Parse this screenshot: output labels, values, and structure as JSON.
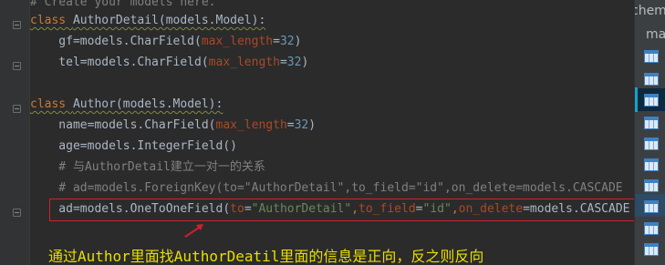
{
  "editor": {
    "lines": [
      {
        "id": "l0",
        "parts": [
          [
            "cmt",
            "# Create your models here."
          ]
        ]
      },
      {
        "id": "l1",
        "parts": [
          [
            "kw",
            "class "
          ],
          [
            "cls",
            "AuthorDetail(models.Model):"
          ]
        ]
      },
      {
        "id": "l2",
        "parts": [
          [
            "cls",
            "    gf=models.CharField("
          ],
          [
            "param",
            "max_length"
          ],
          [
            "cls",
            "="
          ],
          [
            "num",
            "32"
          ],
          [
            "cls",
            ")"
          ]
        ]
      },
      {
        "id": "l3",
        "parts": [
          [
            "cls",
            "    tel=models.CharField("
          ],
          [
            "param",
            "max_length"
          ],
          [
            "cls",
            "="
          ],
          [
            "num",
            "32"
          ],
          [
            "cls",
            ")"
          ]
        ]
      },
      {
        "id": "l4",
        "parts": []
      },
      {
        "id": "l5",
        "parts": [
          [
            "kw",
            "class "
          ],
          [
            "cls",
            "Author(models.Model):"
          ]
        ]
      },
      {
        "id": "l6",
        "parts": [
          [
            "cls",
            "    name=models.CharField("
          ],
          [
            "param",
            "max_length"
          ],
          [
            "cls",
            "="
          ],
          [
            "num",
            "32"
          ],
          [
            "cls",
            ")"
          ]
        ]
      },
      {
        "id": "l7",
        "parts": [
          [
            "cls",
            "    age=models.IntegerField()"
          ]
        ]
      },
      {
        "id": "l8",
        "parts": [
          [
            "cmt",
            "    # 与AuthorDetail建立一对一的关系"
          ]
        ]
      },
      {
        "id": "l9",
        "parts": [
          [
            "cmt",
            "    # ad=models.ForeignKey(to=\"AuthorDetail\",to_field=\"id\",on_delete=models.CASCADE"
          ]
        ]
      },
      {
        "id": "l10",
        "parts": [
          [
            "cls",
            "    ad=models.OneToOneField("
          ],
          [
            "param",
            "to"
          ],
          [
            "cls",
            "="
          ],
          [
            "str",
            "\"AuthorDetail\""
          ],
          [
            "kw",
            ","
          ],
          [
            "param",
            "to_field"
          ],
          [
            "cls",
            "="
          ],
          [
            "str",
            "\"id\""
          ],
          [
            "kw",
            ","
          ],
          [
            "param",
            "on_delete"
          ],
          [
            "cls",
            "=models.CASCADE"
          ]
        ]
      }
    ],
    "annotation": "通过Author里面找AuthorDeatil里面的信息是正向，反之则反向"
  },
  "panel": {
    "top_text": "chem",
    "second_text": "ma"
  },
  "colors": {
    "keyword": "#cc7832",
    "parameter": "#aa4926",
    "number": "#6897bb",
    "string": "#6a8759",
    "comment": "#808080",
    "annotation": "#e8df00",
    "highlight_box": "#d21f2d"
  }
}
